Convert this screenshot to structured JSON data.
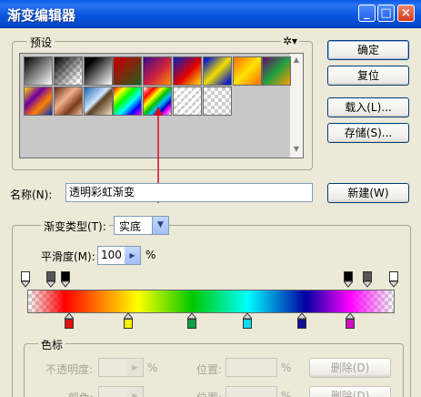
{
  "window": {
    "title": "渐变编辑器"
  },
  "presets": {
    "legend": "预设",
    "swatches": [
      {
        "name": "foreground-to-background",
        "bg": "linear-gradient(135deg,#000 0%,#fff 100%)"
      },
      {
        "name": "foreground-to-transparent",
        "bg": "linear-gradient(135deg,#000 0%,rgba(0,0,0,0) 85%), repeating-conic-gradient(#ccc 0 25%,#fff 0 50%) 0 0/8px 8px"
      },
      {
        "name": "black-white",
        "bg": "linear-gradient(135deg,#000 20%,#fff 100%)"
      },
      {
        "name": "red-green",
        "bg": "linear-gradient(135deg,#c00000 10%,#206020 100%)"
      },
      {
        "name": "violet-orange",
        "bg": "linear-gradient(135deg,#3a0a8a 0%,#d02040 55%,#ff9000 100%)"
      },
      {
        "name": "blue-red-yellow",
        "bg": "linear-gradient(135deg,#0020c0 0%,#e00000 55%,#ffe000 100%)"
      },
      {
        "name": "blue-yellow-blue",
        "bg": "linear-gradient(135deg,#1020c0 10%,#f0e000 50%,#1020c0 90%)"
      },
      {
        "name": "orange-yellow-orange",
        "bg": "linear-gradient(135deg,#ff8000 10%,#ffe400 50%,#ff8000 90%)"
      },
      {
        "name": "violet-green-orange",
        "bg": "linear-gradient(135deg,#6a0a6a 0%,#20a040 50%,#ff9a00 100%)"
      },
      {
        "name": "yellow-violet-orange-blue",
        "bg": "linear-gradient(135deg,#ffd800 0%,#7000a0 35%,#ff8000 65%,#0030c0 100%)"
      },
      {
        "name": "copper",
        "bg": "linear-gradient(135deg,#5a2a10 0%,#f0b090 40%,#7a3a18 70%,#f0c0a0 100%)"
      },
      {
        "name": "chrome",
        "bg": "linear-gradient(135deg,#1a5fb0 0%,#d0e8ff 45%,#5a4020 55%,#f0e0c0 100%)"
      },
      {
        "name": "spectrum",
        "bg": "linear-gradient(135deg,#ff0000,#ffff00,#00ff00,#00ffff,#0000ff,#ff00ff)"
      },
      {
        "name": "transparent-rainbow",
        "bg": "linear-gradient(135deg,rgba(255,0,0,0) 0%,#ff0000 20%,#ffff00 35%,#00c000 50%,#00c0ff 62%,#0000c0 75%,#ff00ff 85%,rgba(255,0,255,0) 100%), repeating-conic-gradient(#ccc 0 25%,#fff 0 50%) 0 0/8px 8px"
      },
      {
        "name": "transparent-stripes",
        "bg": "repeating-linear-gradient(135deg,rgba(255,255,255,0.9) 0 3px,rgba(220,220,220,0) 3px 6px), repeating-conic-gradient(#ccc 0 25%,#fff 0 50%) 0 0/8px 8px"
      },
      {
        "name": "transparent-checker",
        "bg": "repeating-conic-gradient(#ccc 0 25%,#fff 0 50%) 0 0/8px 8px"
      }
    ]
  },
  "buttons": {
    "ok": "确定",
    "reset": "复位",
    "load": "载入(L)...",
    "save": "存储(S)...",
    "new": "新建(W)"
  },
  "name_field": {
    "label": "名称(N):",
    "value": "透明彩虹渐变"
  },
  "gradient_type": {
    "label": "渐变类型(T):",
    "value": "实底"
  },
  "smoothness": {
    "label": "平滑度(M):",
    "value": "100",
    "unit": "%"
  },
  "opacity_stops": [
    {
      "color": "#ffffff"
    },
    {
      "color": "#555555"
    },
    {
      "color": "#000000"
    },
    {
      "color": "#000000"
    },
    {
      "color": "#555555"
    },
    {
      "color": "#ffffff"
    }
  ],
  "color_stops": [
    {
      "color": "#e01010"
    },
    {
      "color": "#ffee00"
    },
    {
      "color": "#10a040"
    },
    {
      "color": "#10d8f0"
    },
    {
      "color": "#101090"
    },
    {
      "color": "#d010c0"
    }
  ],
  "stops_panel": {
    "legend": "色标",
    "opacity_label": "不透明度:",
    "opacity_unit": "%",
    "location_label": "位置:",
    "location_unit": "%",
    "delete_label": "删除(D)",
    "color_label": "颜色:",
    "location2_label": "位置:",
    "location2_unit": "%",
    "delete2_label": "删除(D)"
  }
}
